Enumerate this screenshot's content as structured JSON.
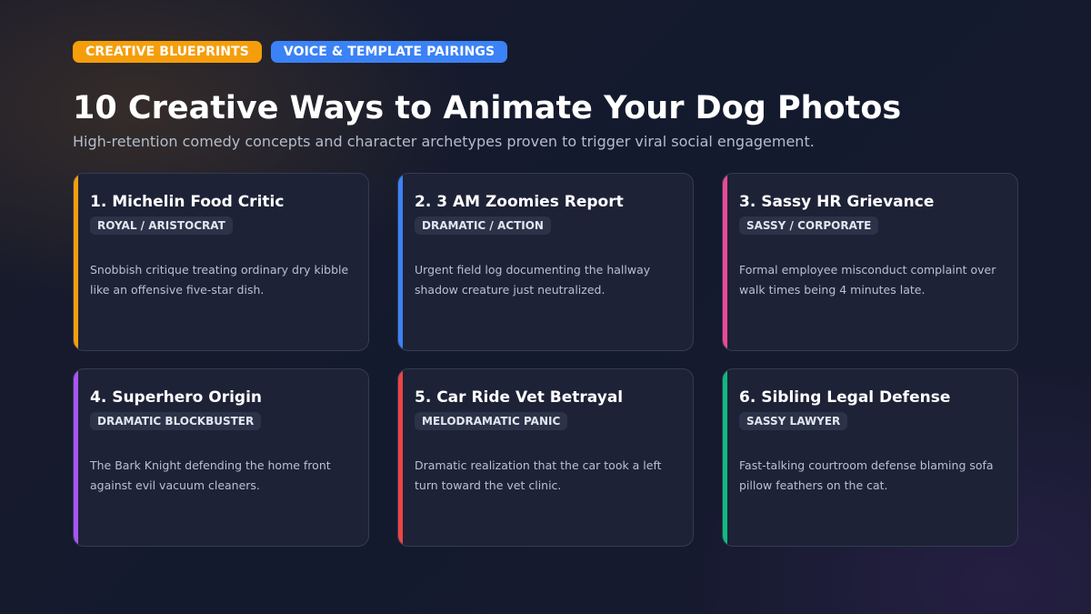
{
  "header": {
    "tags": [
      {
        "label": "CREATIVE BLUEPRINTS",
        "color": "#f59e0b"
      },
      {
        "label": "VOICE & TEMPLATE PAIRINGS",
        "color": "#3b82f6"
      }
    ],
    "title": "10 Creative Ways to Animate Your Dog Photos",
    "subtitle": "High-retention comedy concepts and character archetypes proven to trigger viral social engagement."
  },
  "cards": [
    {
      "title": "1. Michelin Food Critic",
      "badge": "ROYAL / ARISTOCRAT",
      "description": "Snobbish critique treating ordinary dry kibble like an offensive five-star dish.",
      "accent": "#f59e0b"
    },
    {
      "title": "2. 3 AM Zoomies Report",
      "badge": "DRAMATIC / ACTION",
      "description": "Urgent field log documenting the hallway shadow creature just neutralized.",
      "accent": "#3b82f6"
    },
    {
      "title": "3. Sassy HR Grievance",
      "badge": "SASSY / CORPORATE",
      "description": "Formal employee misconduct complaint over walk times being 4 minutes late.",
      "accent": "#ec4899"
    },
    {
      "title": "4. Superhero Origin",
      "badge": "DRAMATIC BLOCKBUSTER",
      "description": "The Bark Knight defending the home front against evil vacuum cleaners.",
      "accent": "#a855f7"
    },
    {
      "title": "5. Car Ride Vet Betrayal",
      "badge": "MELODRAMATIC PANIC",
      "description": "Dramatic realization that the car took a left turn toward the vet clinic.",
      "accent": "#ef4444"
    },
    {
      "title": "6. Sibling Legal Defense",
      "badge": "SASSY LAWYER",
      "description": "Fast-talking courtroom defense blaming sofa pillow feathers on the cat.",
      "accent": "#10b981"
    }
  ]
}
